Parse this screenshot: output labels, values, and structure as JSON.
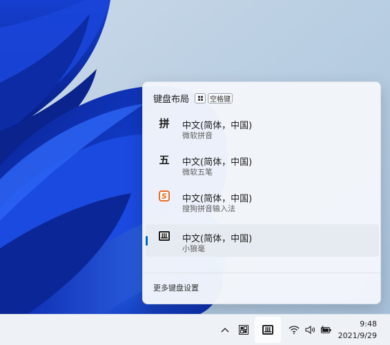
{
  "flyout": {
    "title": "键盘布局",
    "space_key": "空格键",
    "items": [
      {
        "icon": "拼",
        "name": "中文(简体，中国)",
        "sub": "微软拼音",
        "selected": false
      },
      {
        "icon": "五",
        "name": "中文(简体，中国)",
        "sub": "微软五笔",
        "selected": false
      },
      {
        "icon": "S",
        "name": "中文(简体，中国)",
        "sub": "搜狗拼音输入法",
        "selected": false
      },
      {
        "icon": "small-wolf-ime-icon",
        "name": "中文(简体，中国)",
        "sub": "小狼毫",
        "selected": true
      }
    ],
    "more_settings": "更多键盘设置"
  },
  "taskbar": {
    "tray_icons": [
      "chevron-up-icon",
      "ime-mode-icon",
      "small-wolf-ime-icon",
      "wifi-icon",
      "volume-icon",
      "battery-charging-icon"
    ],
    "time": "9:48",
    "date": "2021/9/29"
  },
  "colors": {
    "accent": "#0067c0",
    "sogou_orange": "#ee6a24",
    "flyout_bg": "#f3f6fb",
    "selected_bg": "#e6ebf1"
  }
}
